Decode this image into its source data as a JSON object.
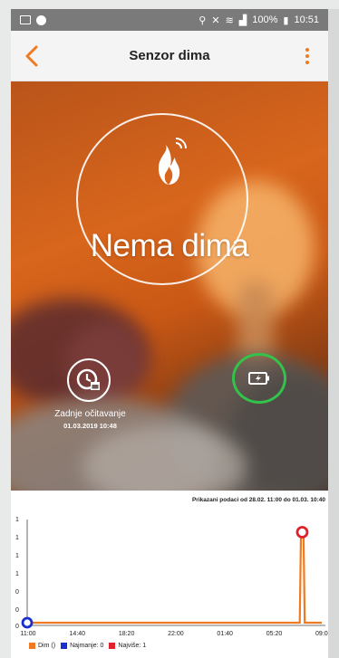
{
  "statusbar": {
    "battery": "100%",
    "time": "10:51"
  },
  "appbar": {
    "title": "Senzor dima"
  },
  "hero": {
    "status": "Nema dima",
    "last_reading_label": "Zadnje očitavanje",
    "last_reading_date": "01.03.2019 10:48"
  },
  "colors": {
    "accent": "#f07a20",
    "battery_ring": "#33c24a",
    "min": "#1a2fd0",
    "max": "#e0202b",
    "line": "#f07a20"
  },
  "chart": {
    "caption": "Prikazani podaci od 28.02. 11:00 do 01.03. 10:40",
    "legend": [
      {
        "label": "Dim ()",
        "color": "#f07a20"
      },
      {
        "label": "Najmanje: 0",
        "color": "#1a2fd0"
      },
      {
        "label": "Najviše: 1",
        "color": "#e0202b"
      }
    ]
  },
  "chart_data": {
    "type": "line",
    "x_ticks": [
      "11:00",
      "14:40",
      "18:20",
      "22:00",
      "01:40",
      "05:20",
      "09:00"
    ],
    "y_ticks": [
      "1",
      "1",
      "1",
      "1",
      "0",
      "0",
      "0"
    ],
    "x_hours": [
      0,
      21.9,
      22.0,
      22.2,
      22.3,
      23.67
    ],
    "values": [
      0,
      0,
      1,
      1,
      0,
      0
    ],
    "ylim": [
      0,
      1
    ],
    "min_point": {
      "x_hours": 0,
      "value": 0
    },
    "max_point": {
      "x_hours": 22.1,
      "value": 1
    }
  }
}
